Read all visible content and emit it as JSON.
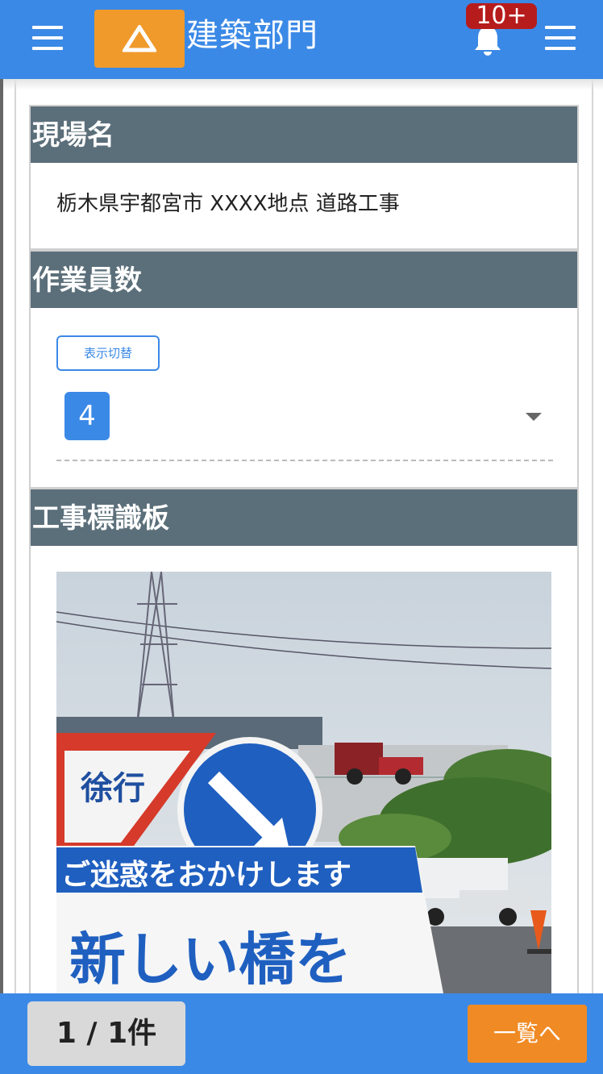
{
  "header": {
    "title": "建築部門",
    "notification_badge": "10+",
    "icons": {
      "left_menu": "hamburger-menu-icon",
      "logo": "triangle-logo-icon",
      "bell": "bell-icon",
      "right_menu": "hamburger-menu-icon"
    },
    "colors": {
      "bar": "#3b89e6",
      "logo": "#f09a2c",
      "badge": "#b71c1c"
    }
  },
  "sections": {
    "site": {
      "heading": "現場名",
      "value": "栃木県宇都宮市 XXXX地点 道路工事"
    },
    "workers": {
      "heading": "作業員数",
      "toggle_label": "表示切替",
      "count": "4"
    },
    "signboard": {
      "heading": "工事標識板",
      "photo_text": {
        "slow": "徐行",
        "banner": "ご迷惑をおかけします",
        "sign_main": "新しい橋を"
      }
    }
  },
  "footer": {
    "pager": "1 / 1件",
    "list_button": "一覧へ",
    "colors": {
      "button": "#f08a24"
    }
  }
}
